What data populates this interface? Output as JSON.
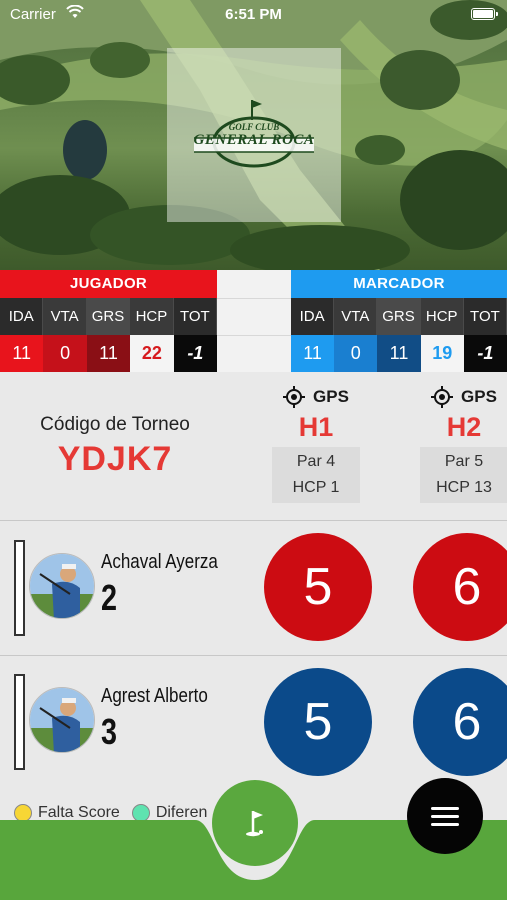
{
  "status_bar": {
    "carrier": "Carrier",
    "time": "6:51 PM"
  },
  "header": {
    "logo_club": "GOLF CLUB",
    "logo_name": "GENERAL ROCA"
  },
  "player_board": {
    "title": "JUGADOR",
    "columns": [
      "IDA",
      "VTA",
      "GRS",
      "HCP",
      "TOT"
    ],
    "values": [
      "11",
      "0",
      "11",
      "22",
      "-1"
    ]
  },
  "marker_board": {
    "title": "MARCADOR",
    "columns": [
      "IDA",
      "VTA",
      "GRS",
      "HCP",
      "TOT"
    ],
    "values": [
      "11",
      "0",
      "11",
      "19",
      "-1"
    ]
  },
  "tournament": {
    "label": "Código de Torneo",
    "code": "YDJK7"
  },
  "holes": [
    {
      "gps_label": "GPS",
      "name": "H1",
      "par": "Par 4",
      "hcp": "HCP 1"
    },
    {
      "gps_label": "GPS",
      "name": "H2",
      "par": "Par 5",
      "hcp": "HCP 13"
    }
  ],
  "players": [
    {
      "name": "Achaval Ayerza",
      "position": "2",
      "scores": [
        "5",
        "6"
      ],
      "score_color": "#cc0c12"
    },
    {
      "name": "Agrest Alberto",
      "position": "3",
      "scores": [
        "5",
        "6"
      ],
      "score_color": "#0b4a8a"
    }
  ],
  "legend": {
    "missing_score": "Falta Score",
    "difference": "Diferen"
  },
  "colors": {
    "accent_red": "#e8141c",
    "accent_blue": "#1e9bf0",
    "green": "#5aa83e"
  }
}
